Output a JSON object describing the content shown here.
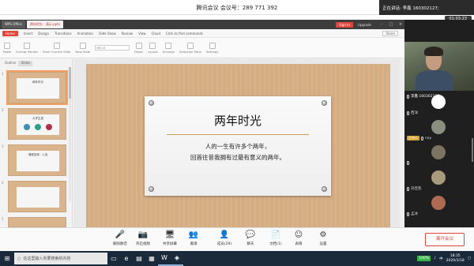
{
  "meeting": {
    "title": "腾讯会议 会议号：289 771 392",
    "speaking_banner": "正在讲话: 李鑫 160302127;",
    "timer": "01:03:23"
  },
  "wps": {
    "tabs": [
      "WPS Office",
      "两年时光 - 演示.pptx"
    ],
    "sign_in": "Sign In",
    "upgrade": "Upgrade",
    "menu": [
      "Home",
      "Insert",
      "Design",
      "Transitions",
      "Animation",
      "Slide Show",
      "Review",
      "View",
      "Cloud",
      "Click to find commands"
    ],
    "share": "Share",
    "toolbar": {
      "font": "MS UI",
      "tools": [
        "Paste",
        "Format Painter",
        "From Current Slide",
        "New Slide",
        "Reset",
        "Layout",
        "Arrange",
        "Selection Pane",
        "Settings"
      ]
    },
    "thumb_tabs": [
      "Outline",
      "Slides"
    ],
    "thumbnails": [
      {
        "num": "1",
        "text": "两年时光"
      },
      {
        "num": "2",
        "text": "大学生涯"
      },
      {
        "num": "3",
        "text": "课程选择 · 入选"
      },
      {
        "num": "4",
        "text": ""
      },
      {
        "num": "5",
        "text": ""
      }
    ],
    "slide": {
      "title": "两年时光",
      "line1": "人的一生有许多个两年，",
      "line2": "回首往昔我拥有过最有意义的两年。"
    }
  },
  "participants": {
    "video_name": "李鑫 160302127",
    "list": [
      {
        "name": "西洋",
        "host": false
      },
      {
        "name": "nxy",
        "host": true,
        "tag": "主持人"
      },
      {
        "name": "",
        "host": false
      },
      {
        "name": "刘佳凯",
        "host": false
      },
      {
        "name": "孟冰",
        "host": false
      }
    ]
  },
  "controls": [
    {
      "label": "解除静音",
      "icon": "🎤"
    },
    {
      "label": "开启视频",
      "icon": "📷"
    },
    {
      "label": "共享屏幕",
      "icon": "🖥"
    },
    {
      "label": "邀请",
      "icon": "👥"
    },
    {
      "label": "成员(29)",
      "icon": "👤"
    },
    {
      "label": "聊天",
      "icon": "💬"
    },
    {
      "label": "文档(1)",
      "icon": "📄"
    },
    {
      "label": "表情",
      "icon": "☺"
    },
    {
      "label": "设置",
      "icon": "⚙"
    }
  ],
  "leave_label": "离开会议",
  "taskbar": {
    "search_placeholder": "在这里输入你要搜索的内容",
    "battery": "100%",
    "ime": "中",
    "time": "18:35",
    "date": "2020/3/18"
  }
}
